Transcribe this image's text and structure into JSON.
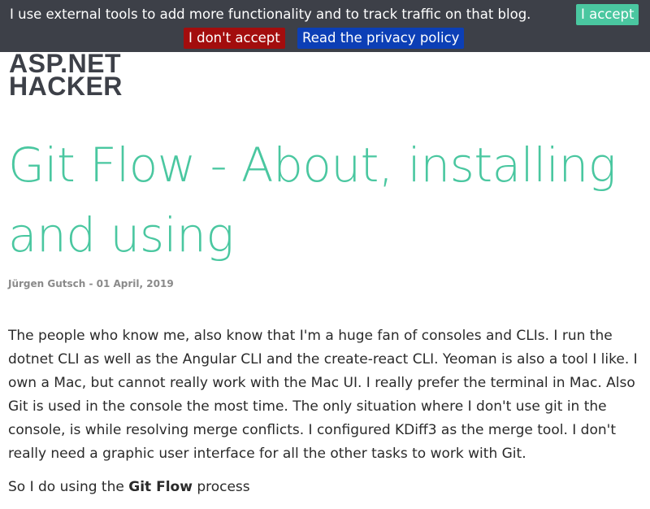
{
  "cookie_banner": {
    "message": "I use external tools to add more functionality and to track traffic on that blog.",
    "accept_label": "I accept",
    "decline_label": "I don't accept",
    "privacy_label": "Read the privacy policy",
    "colors": {
      "background": "#3d4048",
      "accept": "#4ac7a0",
      "decline": "#a30d0d",
      "privacy": "#0c3fb6"
    }
  },
  "logo": {
    "line1": "ASP.NET",
    "line2": "HACKER"
  },
  "post": {
    "title": "Git Flow - About, installing and using",
    "meta": "Jürgen Gutsch - 01 April, 2019",
    "paragraph1": "The people who know me, also know that I'm a huge fan of consoles and CLIs. I run the dotnet CLI as well as the Angular CLI and the create-react CLI. Yeoman is also a tool I like. I own a Mac, but cannot really work with the Mac UI. I really prefer the terminal in Mac. Also Git is used in the console the most time. The only situation where I don't use git in the console, is while resolving merge conflicts. I configured KDiff3 as the merge tool. I don't really need a graphic user interface for all the other tasks to work with Git.",
    "paragraph2_prefix": "So I do using the",
    "paragraph2_bold": "Git Flow",
    "paragraph2_suffix": "process",
    "title_color": "#4ac7a0"
  }
}
